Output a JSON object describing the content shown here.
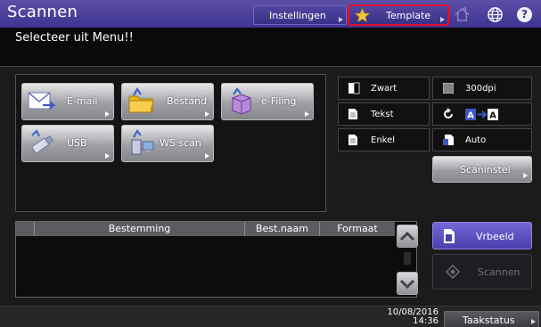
{
  "header": {
    "title": "Scannen",
    "settings_label": "Instellingen",
    "template_label": "Template"
  },
  "message": "Selecteer uit Menu!!",
  "services": {
    "email": "E-mail",
    "file": "Bestand",
    "efiling": "e-Filing",
    "usb": "USB",
    "wsscan": "WS scan"
  },
  "settings": {
    "color": "Zwart",
    "resolution": "300dpi",
    "original_mode": "Tekst",
    "single_double": "Enkel",
    "original_size": "Auto",
    "scan_settings": "Scaninstel"
  },
  "list": {
    "columns": [
      "Bestemming",
      "Best.naam",
      "Formaat"
    ]
  },
  "actions": {
    "preview": "Vrbeeld",
    "scan": "Scannen"
  },
  "footer": {
    "date": "10/08/2016",
    "time": "14:36",
    "job_status": "Taakstatus"
  }
}
